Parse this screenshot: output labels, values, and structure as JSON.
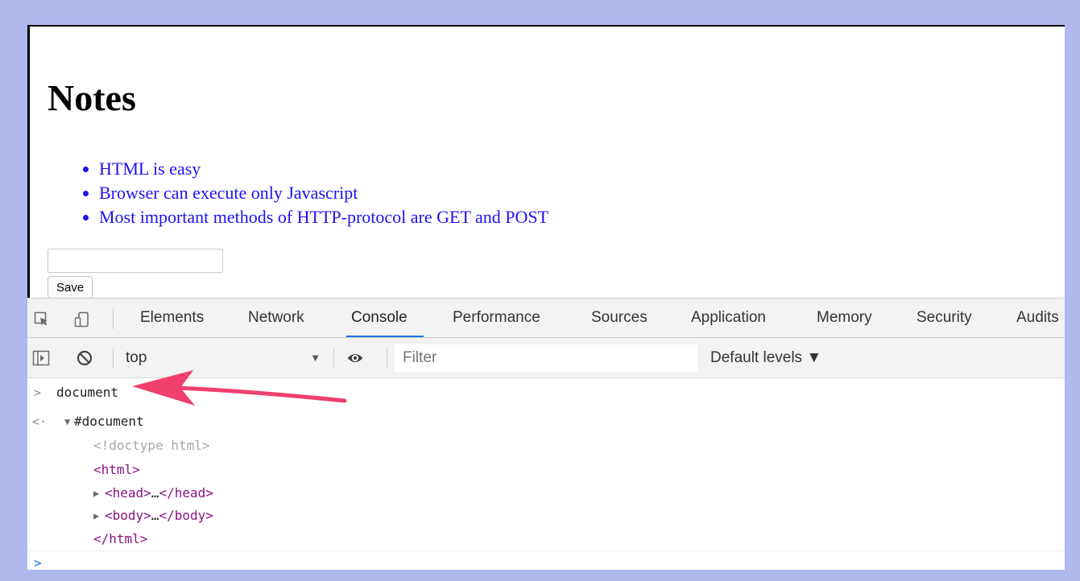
{
  "page": {
    "title": "Notes",
    "notes": [
      "HTML is easy",
      "Browser can execute only Javascript",
      "Most important methods of HTTP-protocol are GET and POST"
    ],
    "note_input_value": "",
    "save_label": "Save"
  },
  "devtools": {
    "tabs": [
      {
        "label": "Elements"
      },
      {
        "label": "Network"
      },
      {
        "label": "Console",
        "active": true
      },
      {
        "label": "Performance"
      },
      {
        "label": "Sources"
      },
      {
        "label": "Application"
      },
      {
        "label": "Memory"
      },
      {
        "label": "Security"
      },
      {
        "label": "Audits"
      }
    ],
    "toolbar": {
      "context": "top",
      "context_arrow": "▼",
      "filter_placeholder": "Filter",
      "levels": "Default levels ▼"
    },
    "console": {
      "prompt": ">",
      "return_marker": "<·",
      "command": "document",
      "tree_root": "#document",
      "doctype": "<!doctype html>",
      "html_open": "<html>",
      "head_open": "<head>",
      "head_ellipsis": "…",
      "head_close": "</head>",
      "body_open": "<body>",
      "body_ellipsis": "…",
      "body_close": "</body>",
      "html_close": "</html>",
      "expand_open_icon": "triangle-down-icon",
      "expand_closed_icon": "triangle-right-icon"
    }
  },
  "colors": {
    "background": "#b0b9ee",
    "link_text": "#1d12f0",
    "tag": "#881280",
    "active_tab": "#1a73e8",
    "annotation_arrow": "#f0406e"
  }
}
